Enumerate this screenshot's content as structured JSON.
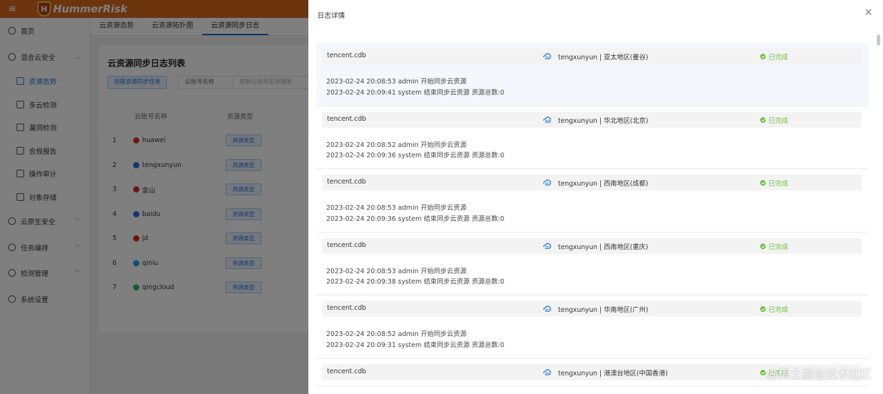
{
  "app": {
    "logo_text": "HummerRisk"
  },
  "sidebar": {
    "items": [
      {
        "label": "首页",
        "icon": "clock-icon"
      },
      {
        "label": "混合云安全",
        "icon": "shield-icon",
        "expanded": true
      },
      {
        "label": "资源态势",
        "icon": "chart-icon",
        "sub": true,
        "active": true
      },
      {
        "label": "多云检测",
        "icon": "scan-icon",
        "sub": true
      },
      {
        "label": "漏洞检测",
        "icon": "bug-icon",
        "sub": true
      },
      {
        "label": "合规报告",
        "icon": "report-icon",
        "sub": true
      },
      {
        "label": "操作审计",
        "icon": "audit-icon",
        "sub": true
      },
      {
        "label": "对象存储",
        "icon": "storage-icon",
        "sub": true
      },
      {
        "label": "云原生安全",
        "icon": "cloud-icon"
      },
      {
        "label": "任务编排",
        "icon": "list-icon"
      },
      {
        "label": "检测管理",
        "icon": "monitor-icon"
      },
      {
        "label": "系统设置",
        "icon": "gear-icon"
      }
    ]
  },
  "tabs": [
    "云资源态势",
    "云资源拓扑图",
    "云资源同步日志"
  ],
  "main": {
    "title": "云资源同步日志列表",
    "create_button": "创建资源同步任务",
    "account_select": "云账号名称",
    "search_placeholder": "根据云账号名称搜索",
    "columns": {
      "account": "云账号名称",
      "resource_type": "资源类型"
    },
    "rows": [
      {
        "index": "1",
        "account": "huawei",
        "badge": "资源类型",
        "color": "#e0312b"
      },
      {
        "index": "2",
        "account": "tengxunyun",
        "badge": "资源类型",
        "color": "#1f6fd6"
      },
      {
        "index": "3",
        "account": "金山",
        "badge": "资源类型",
        "color": "#d9262c"
      },
      {
        "index": "4",
        "account": "baidu",
        "badge": "资源类型",
        "color": "#2d69e0"
      },
      {
        "index": "5",
        "account": "jd",
        "badge": "资源类型",
        "color": "#e1251b"
      },
      {
        "index": "6",
        "account": "qiniu",
        "badge": "资源类型",
        "color": "#18a0f0"
      },
      {
        "index": "7",
        "account": "qingcloud",
        "badge": "资源类型",
        "color": "#2bb673"
      }
    ]
  },
  "drawer": {
    "title": "日志详情",
    "logs": [
      {
        "source": "tencent.cdb",
        "region": "tengxunyun | 亚太地区(曼谷)",
        "status": "已完成",
        "lines": [
          "2023-02-24 20:08:53 admin 开始同步云资源",
          "2023-02-24 20:09:41 system 结束同步云资源 资源总数:0"
        ]
      },
      {
        "source": "tencent.cdb",
        "region": "tengxunyun | 华北地区(北京)",
        "status": "已完成",
        "lines": [
          "2023-02-24 20:08:52 admin 开始同步云资源",
          "2023-02-24 20:09:36 system 结束同步云资源 资源总数:0"
        ]
      },
      {
        "source": "tencent.cdb",
        "region": "tengxunyun | 西南地区(成都)",
        "status": "已完成",
        "lines": [
          "2023-02-24 20:08:53 admin 开始同步云资源",
          "2023-02-24 20:09:36 system 结束同步云资源 资源总数:0"
        ]
      },
      {
        "source": "tencent.cdb",
        "region": "tengxunyun | 西南地区(重庆)",
        "status": "已完成",
        "lines": [
          "2023-02-24 20:08:53 admin 开始同步云资源",
          "2023-02-24 20:09:38 system 结束同步云资源 资源总数:0"
        ]
      },
      {
        "source": "tencent.cdb",
        "region": "tengxunyun | 华南地区(广州)",
        "status": "已完成",
        "lines": [
          "2023-02-24 20:08:52 admin 开始同步云资源",
          "2023-02-24 20:09:31 system 结束同步云资源 资源总数:0"
        ]
      },
      {
        "source": "tencent.cdb",
        "region": "tengxunyun | 港澳台地区(中国香港)",
        "status": "已完成",
        "lines": []
      }
    ]
  },
  "watermark": "@稀土掘金技术社区"
}
